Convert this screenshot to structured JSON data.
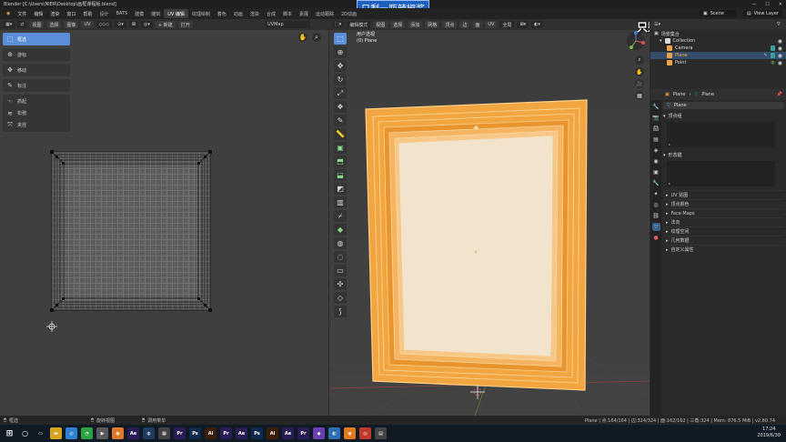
{
  "titlebar": {
    "title": "Blender [C:\\Users\\NIER\\Desktop\\画框课程版.blend]",
    "sticker": "只剩一瓶辣椒酱"
  },
  "menubar": {
    "menus": [
      "文件",
      "编辑",
      "渲染",
      "窗口",
      "帮助"
    ],
    "workspaces": [
      "设计",
      "BATS",
      "建模",
      "雕刻",
      "UV 编辑",
      "纹理绘制",
      "着色",
      "动画",
      "渲染",
      "合成",
      "脚本",
      "素展",
      "运动跟踪",
      "2D动画"
    ],
    "active_workspace": "UV 编辑",
    "scene_label": "Scene",
    "view_layer_label": "View Layer"
  },
  "uv_editor": {
    "header": [
      "视图",
      "选择",
      "图像",
      "UV"
    ],
    "new_button": "+ 新建",
    "open_button": "打开",
    "uvmap": "UVMap",
    "tools": [
      {
        "label": "框选",
        "icon": "select-box-icon",
        "active": true
      },
      {
        "label": "游标",
        "icon": "cursor-icon"
      },
      {
        "label": "移动",
        "icon": "move-icon"
      },
      {
        "label": "标注",
        "icon": "annotate-icon"
      }
    ],
    "tool_group": [
      {
        "label": "抓起",
        "icon": "grab-icon"
      },
      {
        "label": "松弛",
        "icon": "relax-icon"
      },
      {
        "label": "夹捏",
        "icon": "pinch-icon"
      }
    ]
  },
  "viewport": {
    "mode": "编辑模式",
    "header": [
      "视图",
      "选择",
      "添加",
      "网格",
      "顶点",
      "边",
      "面",
      "UV"
    ],
    "transform_orientation": "全局",
    "info_line1": "用户透视",
    "info_line2": "(0) Plane",
    "watermark": "只剩一瓶辣椒酱 bilibili",
    "frame_outer_color": "#f0a94b",
    "frame_inner_color": "#f2e3cc"
  },
  "outliner": {
    "header": "场景集合",
    "rows": [
      {
        "name": "Collection",
        "depth": 1,
        "chip": "#d8d8d8"
      },
      {
        "name": "Camera",
        "depth": 2,
        "chip": "#f0a24b"
      },
      {
        "name": "Plane",
        "depth": 2,
        "chip": "#f0a24b",
        "selected": true
      },
      {
        "name": "Point",
        "depth": 2,
        "chip": "#f0a24b"
      }
    ]
  },
  "properties": {
    "header_object": "Plane",
    "header_data": "Plane",
    "mesh_name": "Plane",
    "vertex_groups": "顶点组",
    "shape_keys": "形态键",
    "subpanels": [
      "UV 贴图",
      "顶点颜色",
      "Face Maps",
      "法向",
      "纹理空间",
      "几何数据",
      "自定义属性"
    ]
  },
  "statusbar": {
    "select": "框选",
    "rotate": "旋转视图",
    "menu": "调用菜单",
    "stats": "Plane | 点:164/164 | 边:324/324 | 面:162/162 | 三角:324 | Mem: 876.5 MiB | v2.80.74"
  },
  "taskbar": {
    "time": "17:24",
    "date": "2019/6/30",
    "apps": [
      {
        "label": "Ae",
        "color": "#2a1d55"
      },
      {
        "label": "Pr",
        "color": "#2a1d55"
      },
      {
        "label": "Ps",
        "color": "#0e2b4d"
      },
      {
        "label": "Ai",
        "color": "#3b1d0a"
      },
      {
        "label": "Pr",
        "color": "#2a1d55"
      },
      {
        "label": "Ae",
        "color": "#2a1d55"
      },
      {
        "label": "Ps",
        "color": "#0e2b4d"
      },
      {
        "label": "Ai",
        "color": "#3b1d0a"
      },
      {
        "label": "Ae",
        "color": "#2a1d55"
      },
      {
        "label": "Pr",
        "color": "#2a1d55"
      }
    ]
  }
}
